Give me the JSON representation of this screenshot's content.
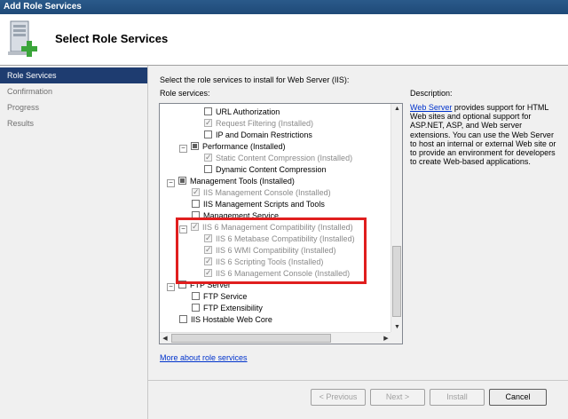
{
  "window": {
    "title": "Add Role Services"
  },
  "header": {
    "title": "Select Role Services",
    "icon": "server-add-icon"
  },
  "sidebar": {
    "items": [
      {
        "label": "Role Services",
        "active": true
      },
      {
        "label": "Confirmation",
        "active": false
      },
      {
        "label": "Progress",
        "active": false
      },
      {
        "label": "Results",
        "active": false
      }
    ]
  },
  "main": {
    "instruction": "Select the role services to install for Web Server (IIS):",
    "role_services_label": "Role services:",
    "more_link": "More about role services"
  },
  "tree": [
    {
      "label": "URL Authorization",
      "state": "unchecked",
      "disabled": false
    },
    {
      "label": "Request Filtering  (Installed)",
      "state": "checked",
      "disabled": true
    },
    {
      "label": "IP and Domain Restrictions",
      "state": "unchecked",
      "disabled": false
    },
    {
      "label": "Performance  (Installed)",
      "state": "partial",
      "disabled": false,
      "expander": "−"
    },
    {
      "label": "Static Content Compression  (Installed)",
      "state": "checked",
      "disabled": true
    },
    {
      "label": "Dynamic Content Compression",
      "state": "unchecked",
      "disabled": false
    },
    {
      "label": "Management Tools  (Installed)",
      "state": "partial",
      "disabled": false,
      "expander": "−"
    },
    {
      "label": "IIS Management Console  (Installed)",
      "state": "checked",
      "disabled": true
    },
    {
      "label": "IIS Management Scripts and Tools",
      "state": "unchecked",
      "disabled": false
    },
    {
      "label": "Management Service",
      "state": "unchecked",
      "disabled": false
    },
    {
      "label": "IIS 6 Management Compatibility  (Installed)",
      "state": "checked",
      "disabled": true,
      "expander": "−"
    },
    {
      "label": "IIS 6 Metabase Compatibility  (Installed)",
      "state": "checked",
      "disabled": true
    },
    {
      "label": "IIS 6 WMI Compatibility  (Installed)",
      "state": "checked",
      "disabled": true
    },
    {
      "label": "IIS 6 Scripting Tools  (Installed)",
      "state": "checked",
      "disabled": true
    },
    {
      "label": "IIS 6 Management Console  (Installed)",
      "state": "checked",
      "disabled": true
    },
    {
      "label": "FTP Server",
      "state": "unchecked",
      "disabled": false,
      "expander": "−"
    },
    {
      "label": "FTP Service",
      "state": "unchecked",
      "disabled": false
    },
    {
      "label": "FTP Extensibility",
      "state": "unchecked",
      "disabled": false
    },
    {
      "label": "IIS Hostable Web Core",
      "state": "unchecked",
      "disabled": false
    }
  ],
  "description": {
    "title": "Description:",
    "link_text": "Web Server",
    "body": " provides support for HTML Web sites and optional support for ASP.NET, ASP, and Web server extensions. You can use the Web Server to host an internal or external Web site or to provide an environment for developers to create Web-based applications."
  },
  "buttons": {
    "previous": "< Previous",
    "next": "Next >",
    "install": "Install",
    "cancel": "Cancel"
  },
  "colors": {
    "highlight": "#e01e1e",
    "sidebar_active": "#1e3c70",
    "link": "#0033cc"
  }
}
